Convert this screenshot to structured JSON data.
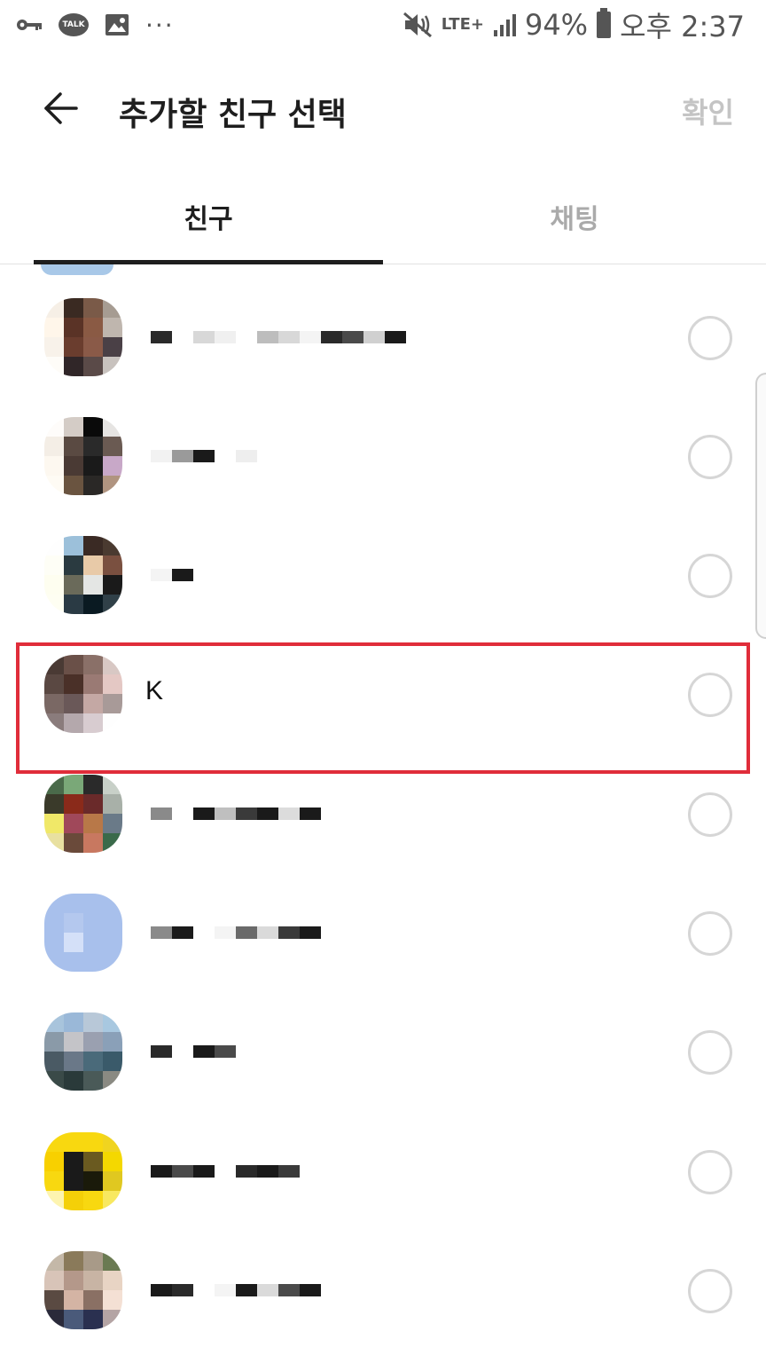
{
  "status_bar": {
    "left_icons": [
      "key-icon",
      "kakaotalk-icon",
      "gallery-icon",
      "more-dots-icon"
    ],
    "talk_label": "TALK",
    "network": "LTE+",
    "battery": "94%",
    "time": "오후 2:37"
  },
  "header": {
    "title": "추가할 친구 선택",
    "confirm_label": "확인"
  },
  "tabs": [
    {
      "label": "친구",
      "selected": true
    },
    {
      "label": "채팅",
      "selected": false
    }
  ],
  "friends": [
    {
      "name": "",
      "avatar": [
        "#f6efe6",
        "#3a2a22",
        "#7a5a48",
        "#a69c92",
        "#fff6ea",
        "#5a3326",
        "#8a5a44",
        "#bfb6ae",
        "#f8f2ea",
        "#6a3d2e",
        "#8a5a48",
        "#4a4046",
        "#fefcf8",
        "#302628",
        "#5a4a48",
        "#c8c2be"
      ],
      "blur": [
        "#2a2a2a",
        "#ffffff",
        "#d8d8d8",
        "#f0f0f0",
        "#ffffff",
        "#bdbdbd",
        "#d8d8d8",
        "#f4f4f4",
        "#2a2a2a",
        "#4a4a4a",
        "#d0d0d0",
        "#1a1a1a"
      ],
      "selected": false
    },
    {
      "name": "",
      "avatar": [
        "#fefcfa",
        "#d4ccc6",
        "#0a0a0a",
        "#e6e4e2",
        "#f4eee6",
        "#5a4a42",
        "#2a2a2a",
        "#6a5a52",
        "#fdf8f0",
        "#4a3a34",
        "#1a1a1a",
        "#c8a8c8",
        "#fefbf4",
        "#6a5440",
        "#2a2826",
        "#b09480"
      ],
      "blur": [
        "#f2f2f2",
        "#9a9a9a",
        "#1a1a1a",
        "#ffffff",
        "#eeeeee"
      ],
      "selected": false
    },
    {
      "name": "",
      "avatar": [
        "#fefefe",
        "#9cc0da",
        "#3a2a24",
        "#4a3a30",
        "#fefef6",
        "#2a3a40",
        "#e8caa8",
        "#7a5040",
        "#fefef0",
        "#6a6a5a",
        "#e4e6e4",
        "#1a1a1a",
        "#fefef2",
        "#2a3a44",
        "#0a1a22",
        "#304048"
      ],
      "blur": [
        "#f4f4f4",
        "#1a1a1a"
      ],
      "selected": false
    },
    {
      "name": "K",
      "avatar": [
        "#4a3a34",
        "#6a5048",
        "#8a7068",
        "#d8c8c4",
        "#5a4842",
        "#4a3028",
        "#9a7a74",
        "#e4c8c4",
        "#7a6864",
        "#6a5858",
        "#c4a8a4",
        "#a89a98",
        "#8a7c7c",
        "#b4a8ac",
        "#d8ccd0",
        "#fefefe"
      ],
      "blur": [],
      "selected": false
    },
    {
      "name": "",
      "avatar": [
        "#4a6a4a",
        "#7aa878",
        "#2a2a2a",
        "#c8d0c8",
        "#3a3a2a",
        "#8a2a1a",
        "#6a2a2a",
        "#a8b0a8",
        "#f0e868",
        "#a0485a",
        "#b87848",
        "#6a7a88",
        "#e8e0a0",
        "#6a4a3a",
        "#c87860",
        "#3a6a4a"
      ],
      "blur": [
        "#8a8a8a",
        "#ffffff",
        "#1a1a1a",
        "#bfbfbf",
        "#3a3a3a",
        "#1a1a1a",
        "#dcdcdc",
        "#1a1a1a"
      ],
      "selected": false
    },
    {
      "name": "",
      "avatar": [
        "#a8c0ec",
        "#a8c0ec",
        "#a8c0ec",
        "#a8c0ec",
        "#a8c0ec",
        "#b4c8ee",
        "#a8c0ec",
        "#a8c0ec",
        "#a8c0ec",
        "#d4e0f8",
        "#a8c0ec",
        "#a8c0ec",
        "#a8c0ec",
        "#a8c0ec",
        "#a8c0ec",
        "#a8c0ec"
      ],
      "blur": [
        "#8a8a8a",
        "#1a1a1a",
        "#ffffff",
        "#f4f4f4",
        "#6a6a6a",
        "#dadada",
        "#3a3a3a",
        "#1a1a1a"
      ],
      "selected": false
    },
    {
      "name": "",
      "avatar": [
        "#a8c4dc",
        "#9ab8d8",
        "#b8c8d8",
        "#a8c8e0",
        "#8a9aa8",
        "#c4c4c8",
        "#9aa0b0",
        "#8aa0b8",
        "#4a5a64",
        "#6a7888",
        "#4a6a7a",
        "#3a5a6a",
        "#3a4a48",
        "#2a3a3a",
        "#4a5a58",
        "#8a8a82"
      ],
      "blur": [
        "#2a2a2a",
        "#ffffff",
        "#1a1a1a",
        "#4a4a4a"
      ],
      "selected": false
    },
    {
      "name": "",
      "avatar": [
        "#f8d810",
        "#f8d810",
        "#f8d810",
        "#f0d420",
        "#f8d000",
        "#1a1a1a",
        "#6a5a20",
        "#f4d800",
        "#f8d810",
        "#1a1a1a",
        "#1a1a0a",
        "#e0c820",
        "#fdf4b0",
        "#f4d008",
        "#f8d810",
        "#f8e860"
      ],
      "blur": [
        "#1a1a1a",
        "#4a4a4a",
        "#1a1a1a",
        "#ffffff",
        "#2a2a2a",
        "#1a1a1a",
        "#3a3a3a",
        "#ffffff"
      ],
      "selected": false
    },
    {
      "name": "",
      "avatar": [
        "#c4b8a8",
        "#8a7a5a",
        "#a89a88",
        "#6a7a52",
        "#d8c4b8",
        "#b4988a",
        "#c8b4a4",
        "#e8d4c4",
        "#5a4a42",
        "#d4b4a4",
        "#8a7064",
        "#f4e0d4",
        "#2a2a3a",
        "#4a5a7a",
        "#2a3050",
        "#b4a4a4"
      ],
      "blur": [
        "#1a1a1a",
        "#2a2a2a",
        "#ffffff",
        "#f4f4f4",
        "#1a1a1a",
        "#dadada",
        "#4a4a4a",
        "#1a1a1a"
      ],
      "selected": false
    }
  ]
}
